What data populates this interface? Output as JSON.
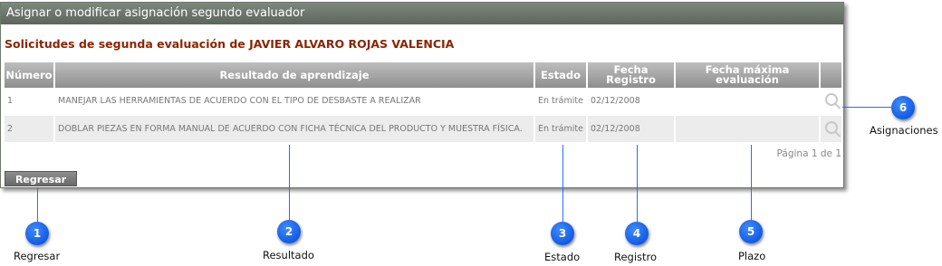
{
  "window": {
    "title": "Asignar o modificar asignación segundo evaluador"
  },
  "subtitle": "Solicitudes de segunda evaluación de JAVIER ALVARO ROJAS VALENCIA",
  "table": {
    "headers": [
      "Número",
      "Resultado de aprendizaje",
      "Estado",
      "Fecha Registro",
      "Fecha máxima evaluación",
      ""
    ],
    "rows": [
      {
        "numero": "1",
        "resultado": "MANEJAR LAS HERRAMIENTAS DE ACUERDO CON EL TIPO DE DESBASTE A REALIZAR",
        "estado": "En trámite",
        "fecha_registro": "02/12/2008",
        "fecha_maxima": ""
      },
      {
        "numero": "2",
        "resultado": "DOBLAR PIEZAS EN FORMA MANUAL DE ACUERDO CON FICHA TÉCNICA DEL PRODUCTO Y MUESTRA FÍSICA.",
        "estado": "En trámite",
        "fecha_registro": "02/12/2008",
        "fecha_maxima": ""
      }
    ]
  },
  "pager": "Página 1 de 1",
  "back_button": "Regresar",
  "callouts": [
    {
      "num": "1",
      "label": "Regresar"
    },
    {
      "num": "2",
      "label": "Resultado"
    },
    {
      "num": "3",
      "label": "Estado"
    },
    {
      "num": "4",
      "label": "Registro"
    },
    {
      "num": "5",
      "label": "Plazo"
    },
    {
      "num": "6",
      "label": "Asignaciones"
    }
  ],
  "colors": {
    "accent": "#0046d6",
    "subtitle": "#8b2500",
    "header": "#8f8f8f"
  }
}
